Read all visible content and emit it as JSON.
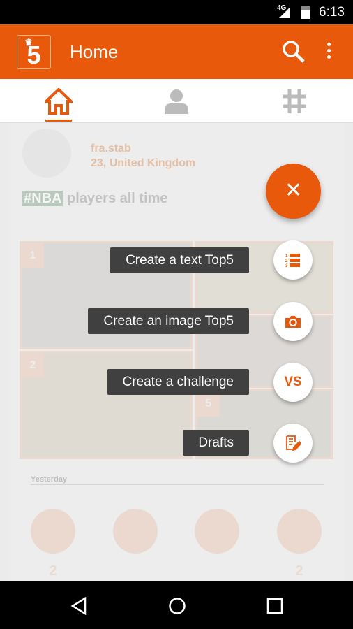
{
  "status_bar": {
    "network": "4G",
    "time": "6:13"
  },
  "app_bar": {
    "logo_text": "5",
    "title": "Home",
    "icons": [
      "search-icon",
      "more-vert-icon"
    ]
  },
  "tabs": [
    {
      "icon": "home-icon",
      "active": true
    },
    {
      "icon": "profile-icon",
      "active": false
    },
    {
      "icon": "hashtag-icon",
      "active": false
    }
  ],
  "post": {
    "username": "fra.stab",
    "location": "23, United Kingdom",
    "hashtag": "#NBA",
    "title": "players all time",
    "ranks": [
      "1",
      "2",
      "5"
    ],
    "date_label": "Yesterday",
    "actions": [
      {
        "icon": "hand-icon",
        "count": "2"
      },
      {
        "icon": "thumbs-down-icon",
        "count": ""
      },
      {
        "icon": "add-rotate-icon",
        "count": ""
      },
      {
        "icon": "refresh-icon",
        "count": "2"
      }
    ]
  },
  "fab_menu": {
    "close_icon": "close-icon",
    "items": [
      {
        "label": "Create a text Top5",
        "icon": "numbered-list-icon"
      },
      {
        "label": "Create an image Top5",
        "icon": "camera-icon"
      },
      {
        "label": "Create a challenge",
        "icon": "vs-icon",
        "icon_text": "VS"
      },
      {
        "label": "Drafts",
        "icon": "edit-document-icon"
      }
    ]
  },
  "colors": {
    "accent": "#E8590C"
  }
}
